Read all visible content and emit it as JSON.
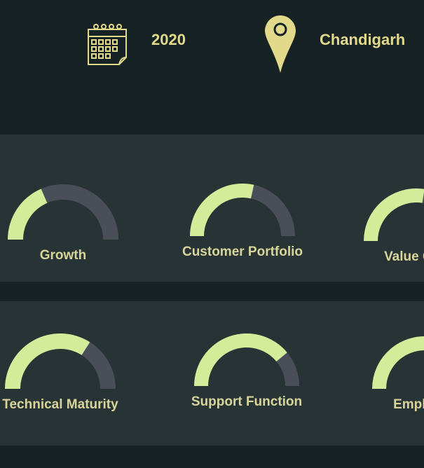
{
  "header": {
    "year": "2020",
    "location": "Chandigarh",
    "calendar_icon": "calendar-icon",
    "location_icon": "map-pin-icon"
  },
  "colors": {
    "background": "#172224",
    "panel": "#283336",
    "gauge_fill": "#d4ec9a",
    "gauge_track": "#4a4e58",
    "label": "#d8d59a",
    "header_text": "#e3d98b",
    "pin": "#e3d98b"
  },
  "gauges": [
    {
      "label": "Growth",
      "fraction": 0.37
    },
    {
      "label": "Customer Portfolio",
      "fraction": 0.57
    },
    {
      "label": "Value Gen",
      "fraction": 0.55
    },
    {
      "label": "Technical Maturity",
      "fraction": 0.68
    },
    {
      "label": "Support Function",
      "fraction": 0.78
    },
    {
      "label": "Employee",
      "fraction": 0.55
    }
  ]
}
